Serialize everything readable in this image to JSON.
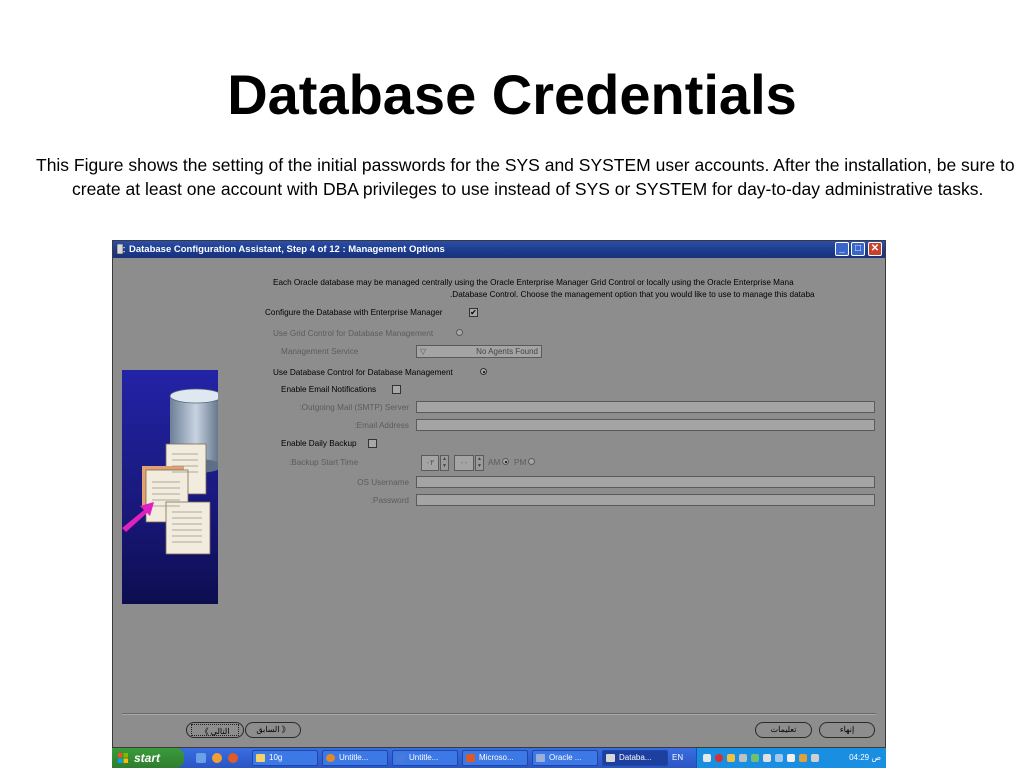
{
  "slide": {
    "title": "Database Credentials",
    "description": "This Figure shows the setting of the initial passwords for the SYS and SYSTEM user accounts. After the installation, be sure to create at least one account with DBA privileges to use instead of SYS or SYSTEM for day-to-day administrative tasks."
  },
  "window": {
    "title": "Database Configuration Assistant, Step 4 of 12 : Management Options",
    "controls": {
      "minimize": "_",
      "maximize": "□",
      "close": "✕"
    },
    "intro_line1": "Each Oracle database may be managed centrally using the Oracle Enterprise Manager Grid Control or locally using the Oracle Enterprise Mana",
    "intro_line2": ".Database Control. Choose the management option that you would like to use to manage this databa",
    "configure_em": {
      "label": "Configure the Database with Enterprise Manager",
      "checked": true,
      "mark": "✔"
    },
    "grid_control": {
      "label": "Use Grid Control for Database Management",
      "selected": false
    },
    "management_service": {
      "label": "Management Service",
      "value": "No Agents Found",
      "arrow": "▽"
    },
    "db_control": {
      "label": "Use Database Control for Database Management",
      "selected": true
    },
    "email_notifications": {
      "label": "Enable Email Notifications",
      "checked": false
    },
    "outgoing_mail": {
      "label": ":Outgoing Mail (SMTP) Server",
      "value": ""
    },
    "email_address": {
      "label": ":Email Address",
      "value": ""
    },
    "daily_backup": {
      "label": "Enable Daily Backup",
      "checked": false
    },
    "backup_time": {
      "label": ":Backup Start Time",
      "hour": "٠٢",
      "minute": "٠٠",
      "am_label": "AM",
      "pm_label": "PM",
      "am_selected": true
    },
    "os_username": {
      "label": "OS Username",
      "value": ""
    },
    "password": {
      "label": ":Password",
      "value": ""
    },
    "buttons": {
      "next": "التالي",
      "back": "السابق",
      "instructions": "تعليمات",
      "finish": "إنهاء",
      "next_arrow": "《",
      "back_arrow": "》"
    }
  },
  "taskbar": {
    "start": "start",
    "items": [
      "10g",
      "Untitle...",
      "Untitle...",
      "Microso...",
      "Oracle ...",
      "Databa..."
    ],
    "language": "EN",
    "clock": "04:29 ص"
  },
  "colors": {
    "dialog_bg": "#8d8d8d",
    "titlebar": "#1c3a8c",
    "taskbar": "#2a55c4",
    "start_button": "#2f7d2f",
    "side_panel": "#18187a"
  }
}
